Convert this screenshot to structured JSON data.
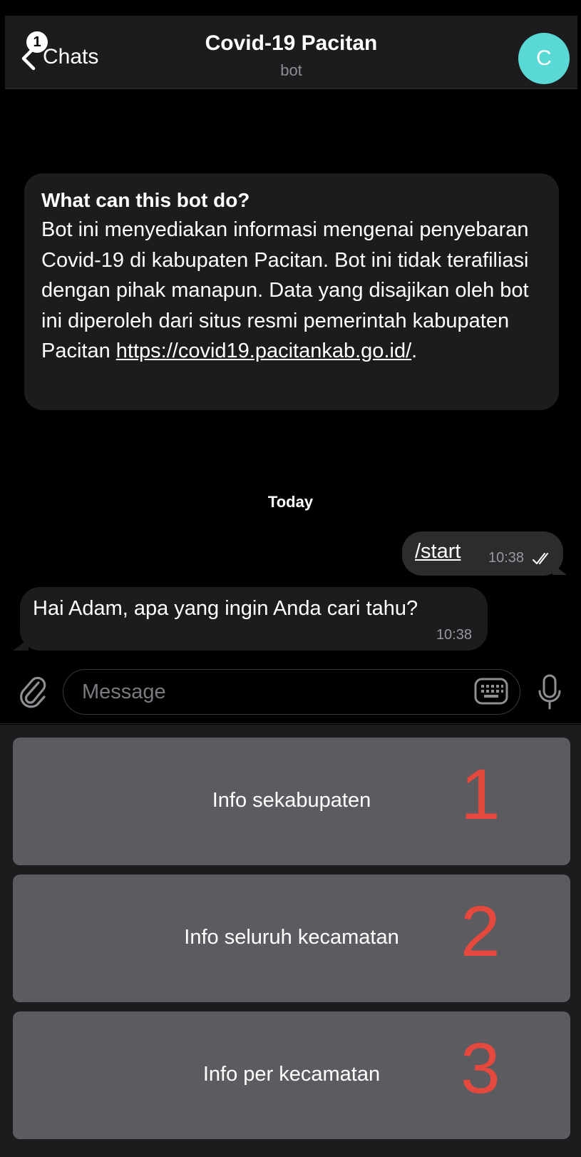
{
  "header": {
    "back_label": "Chats",
    "unread_badge": "1",
    "title": "Covid-19 Pacitan",
    "subtitle": "bot",
    "avatar_letter": "C",
    "avatar_color": "#5ad8d5"
  },
  "intro": {
    "heading": "What can this bot do?",
    "body": "Bot ini menyediakan informasi mengenai penyebaran Covid-19 di kabupaten Pacitan. Bot ini tidak terafiliasi dengan pihak manapun. Data yang disajikan oleh bot ini diperoleh dari situs resmi pemerintah kabupaten Pacitan ",
    "link": "https://covid19.pacitankab.go.id/",
    "after_link": "."
  },
  "date_separator": "Today",
  "messages": [
    {
      "direction": "outgoing",
      "text": "/start",
      "time": "10:38",
      "status": "read"
    },
    {
      "direction": "incoming",
      "text": "Hai Adam, apa yang ingin Anda cari tahu?",
      "time": "10:38"
    }
  ],
  "composer": {
    "placeholder": "Message"
  },
  "keyboard": {
    "buttons": [
      {
        "label": "Info sekabupaten",
        "annotation": "1"
      },
      {
        "label": "Info seluruh kecamatan",
        "annotation": "2"
      },
      {
        "label": "Info per kecamatan",
        "annotation": "3"
      }
    ],
    "annotation_color": "#e5483d"
  }
}
